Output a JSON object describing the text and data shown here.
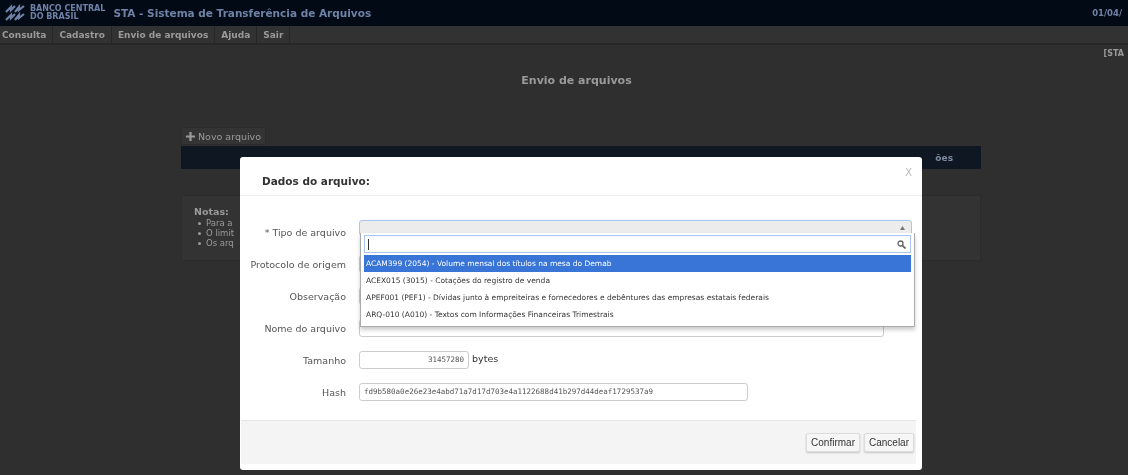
{
  "header": {
    "logo_lines": [
      "BANCO CENTRAL",
      "DO BRASIL"
    ],
    "title": "STA - Sistema de Transferência de Arquivos",
    "date": "01/04/"
  },
  "menu": [
    {
      "label": "Consulta"
    },
    {
      "label": "Cadastro"
    },
    {
      "label": "Envio de arquivos"
    },
    {
      "label": "Ajuda"
    },
    {
      "label": "Sair"
    }
  ],
  "page": {
    "user_tag": "[STA",
    "heading": "Envio de arquivos",
    "new_button": "Novo arquivo",
    "table_header_text": "ões",
    "notes": {
      "title": "Notas:",
      "items": [
        "Para a",
        "O limit",
        "Os arq"
      ]
    }
  },
  "modal": {
    "title": "Dados do arquivo:",
    "close": "X",
    "fields": [
      {
        "kind": "select",
        "label": "* Tipo de arquivo"
      },
      {
        "kind": "text",
        "label": "Protocolo de origem"
      },
      {
        "kind": "text",
        "label": "Observação"
      },
      {
        "kind": "text",
        "label": "Nome do arquivo"
      },
      {
        "kind": "number",
        "label": "Tamanho",
        "value": "31457280",
        "unit": "bytes"
      },
      {
        "kind": "hash",
        "label": "Hash",
        "value": "fd9b580a0e26e23e4abd71a7d17d703e4a1122688d41b297d44deaf1729537a9"
      }
    ],
    "dropdown": {
      "options": [
        {
          "label": "ACAM399 (2054) - Volume mensal dos títulos na mesa do Demab",
          "selected": true
        },
        {
          "label": "ACEX015 (3015) - Cotações do registro de venda",
          "selected": false
        },
        {
          "label": "APEF001 (PEF1) - Dívidas junto à empreiteiras e fornecedores e debêntures das empresas estatais federais",
          "selected": false
        },
        {
          "label": "ARQ-010 (A010) - Textos com Informações Financeiras Trimestrais",
          "selected": false
        }
      ]
    },
    "buttons": [
      "Confirmar",
      "Cancelar"
    ]
  }
}
